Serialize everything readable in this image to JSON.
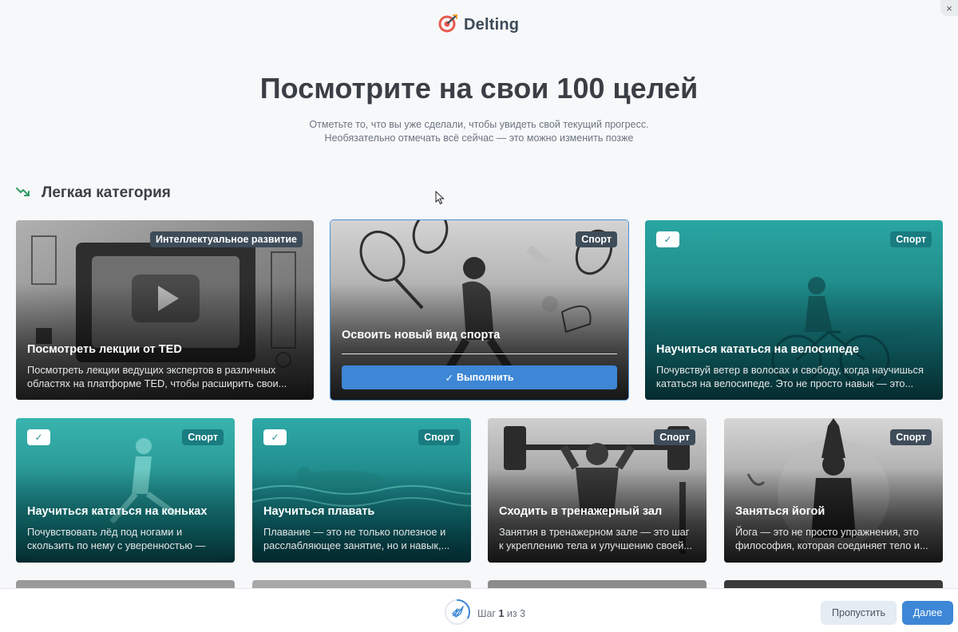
{
  "app": {
    "name": "Delting",
    "close_glyph": "×"
  },
  "hero": {
    "title": "Посмотрите на свои 100 целей",
    "subtitle_line1": "Отметьте то, что вы уже сделали, чтобы увидеть свой текущий прогресс.",
    "subtitle_line2": "Необязательно отмечать всё сейчас — это можно изменить позже"
  },
  "section": {
    "title": "Легкая категория",
    "icon": "trend-down-icon",
    "icon_color": "#2f9a63"
  },
  "cards": [
    {
      "tag": "Интеллектуальное развитие",
      "title": "Посмотреть лекции от TED",
      "desc": "Посмотреть лекции ведущих экспертов в различных областях на платформе TED, чтобы расширить свои...",
      "checked": false,
      "theme": "gray"
    },
    {
      "tag": "Спорт",
      "title": "Освоить новый вид спорта",
      "button": "Выполнить",
      "checked": false,
      "theme": "gray",
      "hovered": true
    },
    {
      "tag": "Спорт",
      "title": "Научиться кататься на велосипеде",
      "desc": "Почувствуй ветер в волосах и свободу, когда научишься кататься на велосипеде. Это не просто навык — это...",
      "checked": true,
      "theme": "teal"
    },
    {
      "tag": "Спорт",
      "title": "Научиться кататься на коньках",
      "desc": "Почувствовать лёд под ногами и скользить по нему с уверенностью — это...",
      "checked": true,
      "theme": "teal"
    },
    {
      "tag": "Спорт",
      "title": "Научиться плавать",
      "desc": "Плавание — это не только полезное и расслабляющее занятие, но и навык,...",
      "checked": true,
      "theme": "teal"
    },
    {
      "tag": "Спорт",
      "title": "Сходить в тренажерный зал",
      "desc": "Занятия в тренажерном зале — это шаг к укреплению тела и улучшению своей...",
      "checked": false,
      "theme": "gray"
    },
    {
      "tag": "Спорт",
      "title": "Заняться йогой",
      "desc": "Йога — это не просто упражнения, это философия, которая соединяет тело и...",
      "checked": false,
      "theme": "gray"
    }
  ],
  "footer": {
    "step_prefix": "Шаг",
    "step_current": "1",
    "step_sep": "из",
    "step_total": "3",
    "progress_fraction": 0.33,
    "skip_label": "Пропустить",
    "next_label": "Далее"
  },
  "colors": {
    "accent": "#3d87d6",
    "teal": "#197c80",
    "tag_gray": "#3e4c59"
  }
}
